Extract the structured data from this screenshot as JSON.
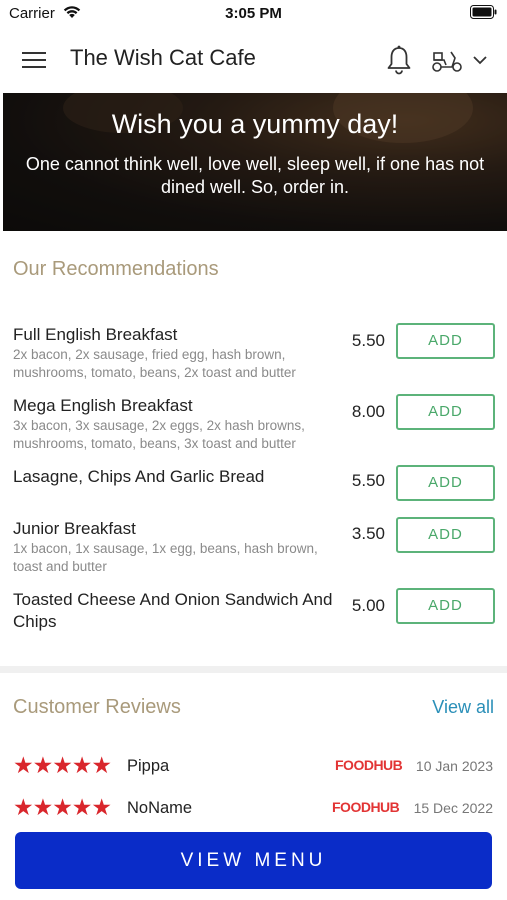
{
  "status_bar": {
    "carrier": "Carrier",
    "time": "3:05 PM"
  },
  "header": {
    "title": "The Wish Cat Cafe"
  },
  "banner": {
    "headline": "Wish you a yummy day!",
    "tagline": "One cannot think well, love well, sleep well, if one has not dined well. So, order in."
  },
  "recommendations": {
    "title": "Our Recommendations",
    "items": [
      {
        "name": "Full English Breakfast",
        "description": "2x bacon, 2x sausage, fried egg, hash brown, mushrooms, tomato, beans, 2x toast and butter",
        "price": "5.50",
        "add_label": "ADD"
      },
      {
        "name": "Mega English Breakfast",
        "description": "3x bacon, 3x sausage, 2x eggs, 2x hash browns, mushrooms, tomato, beans, 3x toast and butter",
        "price": "8.00",
        "add_label": "ADD"
      },
      {
        "name": "Lasagne, Chips And Garlic Bread",
        "description": "",
        "price": "5.50",
        "add_label": "ADD"
      },
      {
        "name": "Junior Breakfast",
        "description": "1x bacon, 1x sausage, 1x egg, beans, hash brown, toast and butter",
        "price": "3.50",
        "add_label": "ADD"
      },
      {
        "name": "Toasted Cheese And Onion Sandwich And Chips",
        "description": "",
        "price": "5.00",
        "add_label": "ADD"
      }
    ]
  },
  "reviews": {
    "title": "Customer Reviews",
    "view_all_label": "View all",
    "items": [
      {
        "rating": 5,
        "reviewer": "Pippa",
        "source": "FOODHUB",
        "date": "10 Jan 2023"
      },
      {
        "rating": 5,
        "reviewer": "NoName",
        "source": "FOODHUB",
        "date": "15 Dec 2022"
      }
    ]
  },
  "view_menu_label": "VIEW MENU",
  "colors": {
    "accent_green": "#4aa86a",
    "primary_blue": "#0a2cc8",
    "section_title": "#a99a7b",
    "star_red": "#d9262c",
    "link_blue": "#2a8fb8"
  }
}
